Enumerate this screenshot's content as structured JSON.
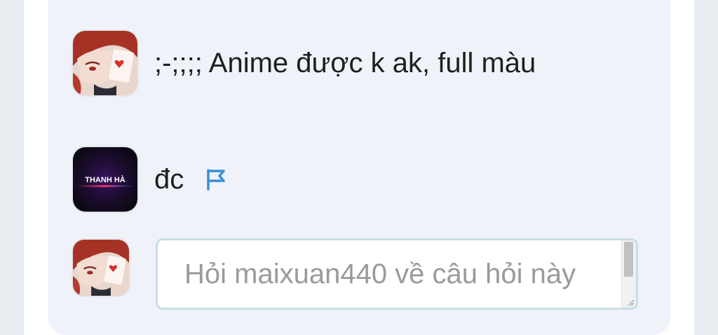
{
  "comments": [
    {
      "avatar_icon": "anime-character-avatar-icon",
      "text": ";-;;;; Anime được k ak, full màu"
    },
    {
      "avatar_icon": "thanh-ha-logo-avatar-icon",
      "avatar_text": "THANH HÀ",
      "text": "đc",
      "flag_icon": "report-flag-icon"
    }
  ],
  "reply": {
    "avatar_icon": "anime-character-avatar-icon",
    "placeholder": "Hỏi maixuan440 về câu hỏi này"
  },
  "colors": {
    "panel_bg": "#eff3f9",
    "flag_blue": "#3a8fd6",
    "input_border": "#c9dde3"
  }
}
